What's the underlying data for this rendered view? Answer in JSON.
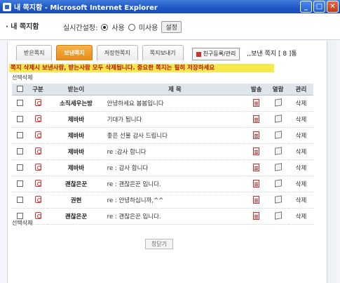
{
  "window": {
    "title": "내 쪽지함 - Microsoft Internet Explorer",
    "buttons": {
      "minimize": "_",
      "maximize": "□",
      "close": "✕"
    }
  },
  "header": {
    "title": "· 내 쪽지함",
    "realtime_label": "실시간설정:",
    "option_use": "사용",
    "option_nouse": "미사용",
    "settings_button": "설정"
  },
  "tabs": [
    {
      "label": "받은쪽지",
      "active": false
    },
    {
      "label": "보낸쪽지",
      "active": true
    },
    {
      "label": "저장한쪽지",
      "active": false
    },
    {
      "label": "쪽지보내기",
      "active": false
    }
  ],
  "friend_button": "친구등록/관리",
  "sent_count": ",,보낸 쪽지 [ 8 ]통",
  "notice": "쪽지 삭제시 보낸사람, 받는사람 모두 삭제됩니다. 중요한 쪽지는 필히 저장하세요",
  "select_delete": "선택삭제",
  "table": {
    "columns": [
      "구분",
      "받는이",
      "제 목",
      "발송",
      "열람",
      "관리"
    ],
    "rows": [
      {
        "recipient": "소직세우는방",
        "subject": "안녕하세요 봄봄입니다",
        "action": "삭제"
      },
      {
        "recipient": "제바바",
        "subject": "기대가 됩니다",
        "action": "삭제"
      },
      {
        "recipient": "제바바",
        "subject": "좋은 선물 감사 드립니다",
        "action": "삭제"
      },
      {
        "recipient": "제바바",
        "subject": "re :감사 합니다",
        "action": "삭제"
      },
      {
        "recipient": "제바바",
        "subject": "re : 감사 합니다",
        "action": "삭제"
      },
      {
        "recipient": "괜찮은꾼",
        "subject": "re : 괜찮은꾼 입니다.",
        "action": "삭제"
      },
      {
        "recipient": "권현",
        "subject": "re : 안녕하십니까,^^",
        "action": "삭제"
      },
      {
        "recipient": "괜찮은꾼",
        "subject": "re : 괜찮은꾼 입니다.",
        "action": "삭제"
      }
    ]
  },
  "close_button": "창닫기"
}
